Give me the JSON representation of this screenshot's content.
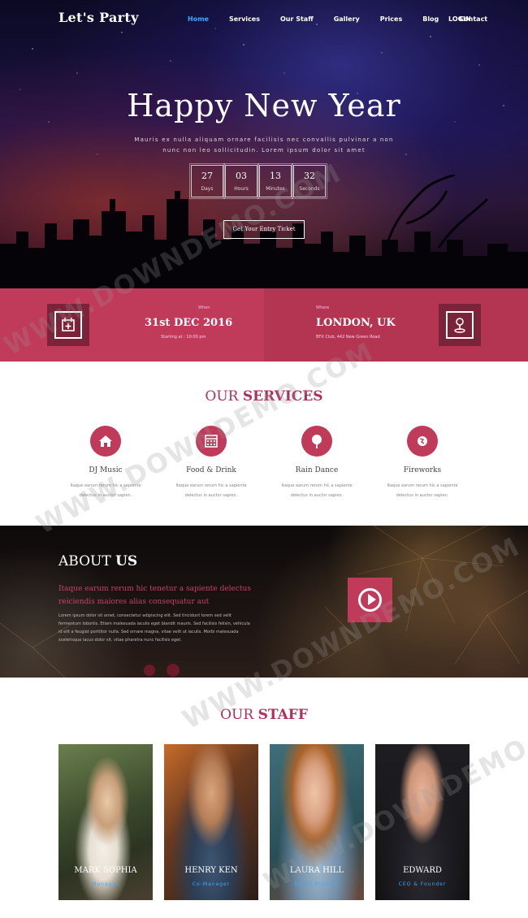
{
  "nav": {
    "logo": "Let's Party",
    "items": [
      "Home",
      "Services",
      "Our Staff",
      "Gallery",
      "Prices",
      "Blog",
      "Contact"
    ],
    "active": "Home",
    "login": "LOGIN"
  },
  "hero": {
    "title": "Happy New Year",
    "subtitle": "Mauris ex nulla aliquam ornare facilisis nec convallis pulvinar a non nunc non leo sollicitudin. Lorem ipsum dolor sit amet",
    "countdown": [
      {
        "value": "27",
        "label": "Days"
      },
      {
        "value": "03",
        "label": "Hours"
      },
      {
        "value": "13",
        "label": "Minutes"
      },
      {
        "value": "32",
        "label": "Seconds"
      }
    ],
    "cta": "Get Your Entry Ticket"
  },
  "event": {
    "when_label": "When",
    "when_value": "31st DEC 2016",
    "when_detail": "Starting at : 10:00 pm",
    "where_label": "Where",
    "where_value": "LONDON, UK",
    "where_detail": "BFX Club, 442 New Green Road"
  },
  "services": {
    "title_light": "OUR",
    "title_bold": "SERVICES",
    "items": [
      {
        "name": "DJ Music",
        "desc_line1": "Itaque earum rerum hic a sapiente",
        "desc_line2": "delectus in auctor sapien.",
        "icon": "home-icon"
      },
      {
        "name": "Food & Drink",
        "desc_line1": "Itaque earum rerum hic a sapiente",
        "desc_line2": "delectus in auctor sapien.",
        "icon": "calendar-icon"
      },
      {
        "name": "Rain Dance",
        "desc_line1": "Itaque earum rerum hic a sapiente",
        "desc_line2": "delectus in auctor sapien.",
        "icon": "tree-icon"
      },
      {
        "name": "Fireworks",
        "desc_line1": "Itaque earum rerum hic a sapiente",
        "desc_line2": "delectus in auctor sapien.",
        "icon": "globe-icon"
      }
    ]
  },
  "about": {
    "title_light": "ABOUT",
    "title_bold": "US",
    "lead": "Itaque earum rerum hic tenetur a sapiente delectus reiciendis maiores alias consequatur aut",
    "body": "Lorem ipsum dolor sit amet, consectetur adipiscing elit. Sed tincidunt lorem sed velit fermentum lobortis. Etiam malesuada iaculis eget blandit mauris. Sed facilisis felisin, vehicula id elit a feugiat porttitor nulla. Sed ornare magna, vitae velit ut iaculis. Morbi malesuada scelerisque lacus dolor sit, vitae pharetra nunc facilisis eget."
  },
  "staff": {
    "title_light": "OUR",
    "title_bold": "STAFF",
    "members": [
      {
        "name": "MARK SOPHIA",
        "role": "Manager"
      },
      {
        "name": "HENRY KEN",
        "role": "Co-Manager"
      },
      {
        "name": "LAURA HILL",
        "role": "Event Planner"
      },
      {
        "name": "EDWARD",
        "role": "CEO & Founder"
      }
    ]
  },
  "colors": {
    "accent": "#c03a5a",
    "accent_dark": "#7c2239",
    "nav_active": "#3fa9ff"
  },
  "watermark": "WWW.DOWNDEMO.COM"
}
